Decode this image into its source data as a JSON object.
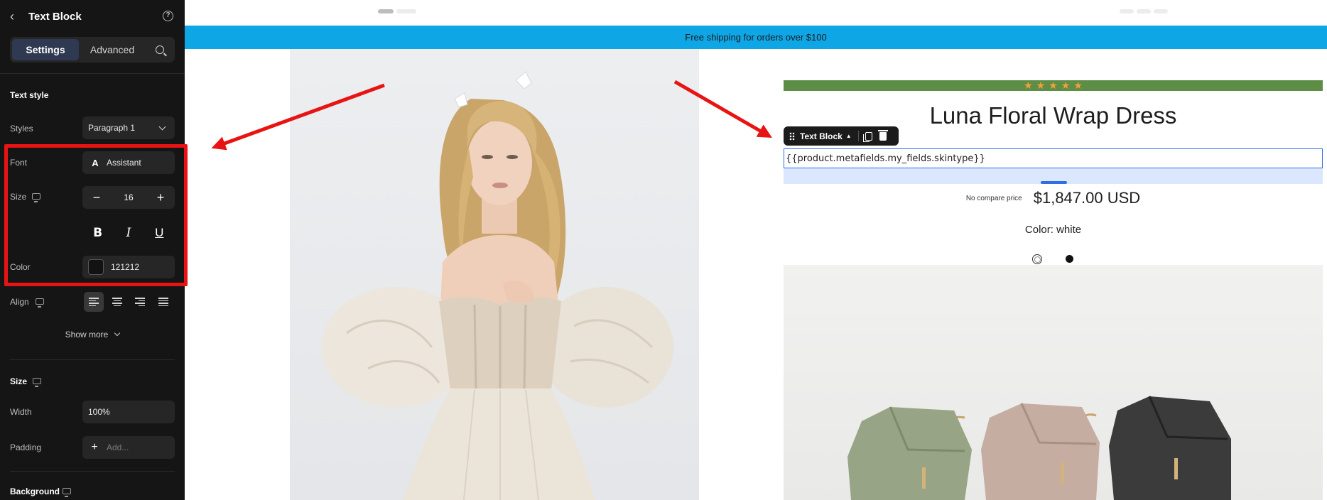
{
  "panel": {
    "title": "Text Block",
    "tabs": {
      "settings": "Settings",
      "advanced": "Advanced"
    },
    "text_style": {
      "section_title": "Text style",
      "styles_label": "Styles",
      "styles_value": "Paragraph 1",
      "font_label": "Font",
      "font_icon_letter": "A",
      "font_value": "Assistant",
      "size_label": "Size",
      "size_value": "16",
      "color_label": "Color",
      "color_value": "121212",
      "align_label": "Align",
      "show_more": "Show more"
    },
    "size_section": {
      "section_title": "Size",
      "width_label": "Width",
      "width_value": "100%",
      "padding_label": "Padding",
      "padding_placeholder": "Add..."
    },
    "background_section": {
      "section_title": "Background"
    }
  },
  "canvas": {
    "banner": "Free shipping for orders over $100",
    "rating_stars": [
      "★",
      "★",
      "★",
      "★",
      "★"
    ],
    "product_title": "Luna Floral Wrap Dress",
    "toolbar": {
      "label": "Text Block",
      "caret": "▲"
    },
    "text_block_content": "{{product.metafields.my_fields.skintype}}",
    "no_compare_price": "No compare price",
    "price": "$1,847.00 USD",
    "color_label": "Color: white",
    "color_options": [
      "white",
      "black"
    ]
  },
  "colors": {
    "panel_bg": "#151515",
    "banner_bg": "#0fa6e6",
    "rating_bar_bg": "#5e8d46",
    "star_color": "#f4a03a",
    "selection_blue": "#2f6ee6",
    "annotation_red": "#e81414",
    "text_color_swatch": "#121212"
  }
}
